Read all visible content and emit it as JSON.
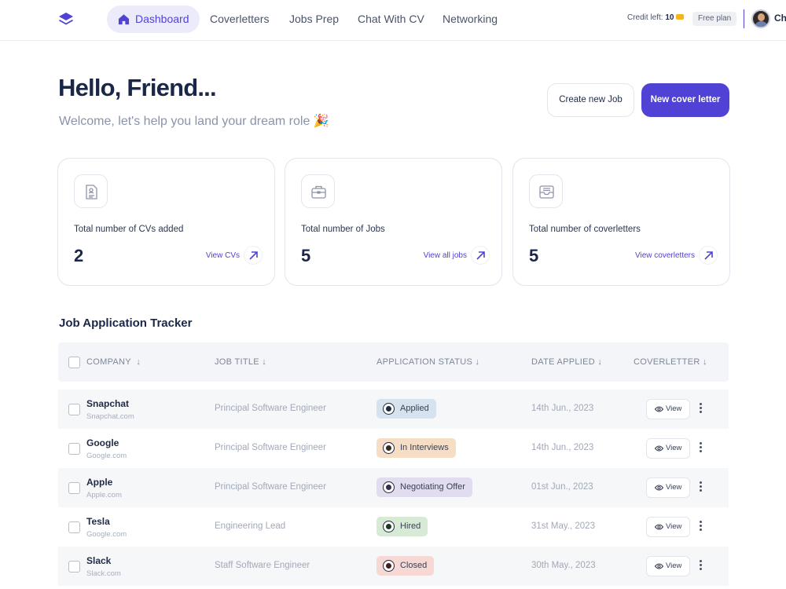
{
  "nav": {
    "items": [
      {
        "label": "Dashboard",
        "active": true
      },
      {
        "label": "Coverletters"
      },
      {
        "label": "Jobs Prep"
      },
      {
        "label": "Chat With CV"
      },
      {
        "label": "Networking"
      }
    ],
    "credit_label": "Credit left:",
    "credit_value": "10",
    "plan": "Free plan",
    "user": "Ch"
  },
  "hero": {
    "title": "Hello, Friend...",
    "subtitle": "Welcome, let's help you land your dream role 🎉",
    "create_job_label": "Create new Job",
    "new_cover_letter_label": "New cover letter"
  },
  "cards": [
    {
      "label": "Total number of CVs added",
      "value": "2",
      "link": "View CVs",
      "icon": "document-icon"
    },
    {
      "label": "Total number of Jobs",
      "value": "5",
      "link": "View all jobs",
      "icon": "briefcase-icon"
    },
    {
      "label": "Total number of coverletters",
      "value": "5",
      "link": "View coverletters",
      "icon": "inbox-icon"
    }
  ],
  "tracker": {
    "title": "Job Application Tracker",
    "columns": [
      "COMPANY",
      "JOB TITLE",
      "APPLICATION STATUS",
      "DATE APPLIED",
      "COVERLETTER"
    ],
    "view_label": "View",
    "rows": [
      {
        "company": "Snapchat",
        "domain": "Snapchat.com",
        "title": "Principal Software Engineer",
        "status": "Applied",
        "date": "14th Jun., 2023"
      },
      {
        "company": "Google",
        "domain": "Google.com",
        "title": "Principal Software Engineer",
        "status": "In Interviews",
        "date": "14th Jun., 2023"
      },
      {
        "company": "Apple",
        "domain": "Apple.com",
        "title": "Principal Software Engineer",
        "status": "Negotiating Offer",
        "date": "01st Jun., 2023"
      },
      {
        "company": "Tesla",
        "domain": "Google.com",
        "title": "Engineering Lead",
        "status": "Hired",
        "date": "31st May., 2023"
      },
      {
        "company": "Slack",
        "domain": "Slack.com",
        "title": "Staff Software Engineer",
        "status": "Closed",
        "date": "30th May., 2023"
      }
    ]
  },
  "colors": {
    "accent": "#5142d6",
    "status_applied": "#d6e2ed",
    "status_interviews": "#f5ddc6",
    "status_offer": "#e2dcef",
    "status_hired": "#d6ead5",
    "status_closed": "#f6d8d4"
  }
}
